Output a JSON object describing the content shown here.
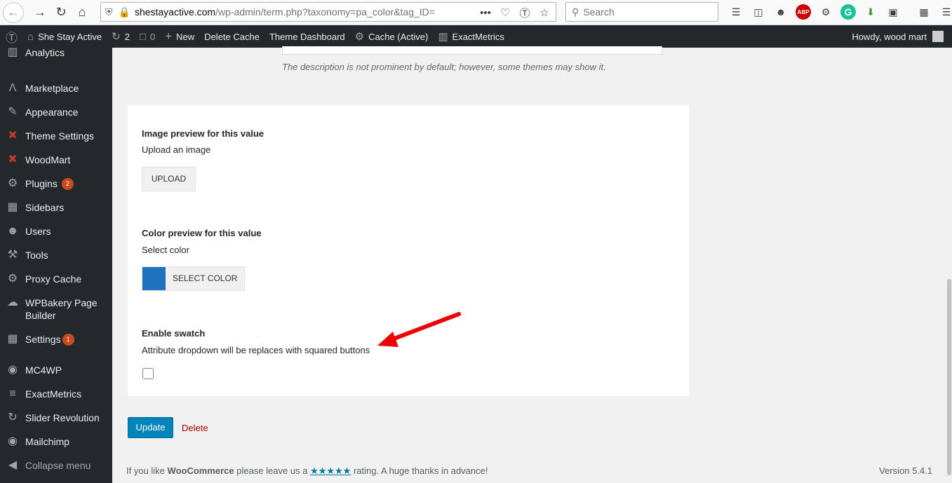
{
  "browser": {
    "url_host": "shestayactive.com",
    "url_path": "/wp-admin/term.php?taxonomy=pa_color&tag_ID=",
    "search_placeholder": "Search"
  },
  "admin_bar": {
    "site_name": "She Stay Active",
    "updates_count": "2",
    "comments_count": "0",
    "new_label": "New",
    "delete_cache": "Delete Cache",
    "theme_dashboard": "Theme Dashboard",
    "cache_active": "Cache (Active)",
    "exactmetrics": "ExactMetrics",
    "howdy": "Howdy, wood mart"
  },
  "sidebar": {
    "items": [
      {
        "label": "Analytics"
      },
      {
        "label": "Marketplace"
      },
      {
        "label": "Appearance"
      },
      {
        "label": "Theme Settings"
      },
      {
        "label": "WoodMart"
      },
      {
        "label": "Plugins",
        "badge": "2"
      },
      {
        "label": "Sidebars"
      },
      {
        "label": "Users"
      },
      {
        "label": "Tools"
      },
      {
        "label": "Proxy Cache"
      },
      {
        "label": "WPBakery Page",
        "label2": "Builder"
      },
      {
        "label": "Settings",
        "badge": "1"
      },
      {
        "label": "MC4WP"
      },
      {
        "label": "ExactMetrics"
      },
      {
        "label": "Slider Revolution"
      },
      {
        "label": "Mailchimp"
      },
      {
        "label": "Collapse menu"
      }
    ]
  },
  "main": {
    "description_note": "The description is not prominent by default; however, some themes may show it.",
    "image_preview": {
      "title": "Image preview for this value",
      "desc": "Upload an image",
      "button": "UPLOAD"
    },
    "color_preview": {
      "title": "Color preview for this value",
      "desc": "Select color",
      "button": "SELECT COLOR",
      "swatch_color": "#1e73be"
    },
    "enable_swatch": {
      "title": "Enable swatch",
      "desc": "Attribute dropdown will be replaces with squared buttons"
    },
    "update_button": "Update",
    "delete_link": "Delete"
  },
  "footer": {
    "text_before": "If you like ",
    "brand": "WooCommerce",
    "text_mid": " please leave us a ",
    "stars": "★★★★★",
    "text_after": " rating. A huge thanks in advance!",
    "version": "Version 5.4.1"
  }
}
